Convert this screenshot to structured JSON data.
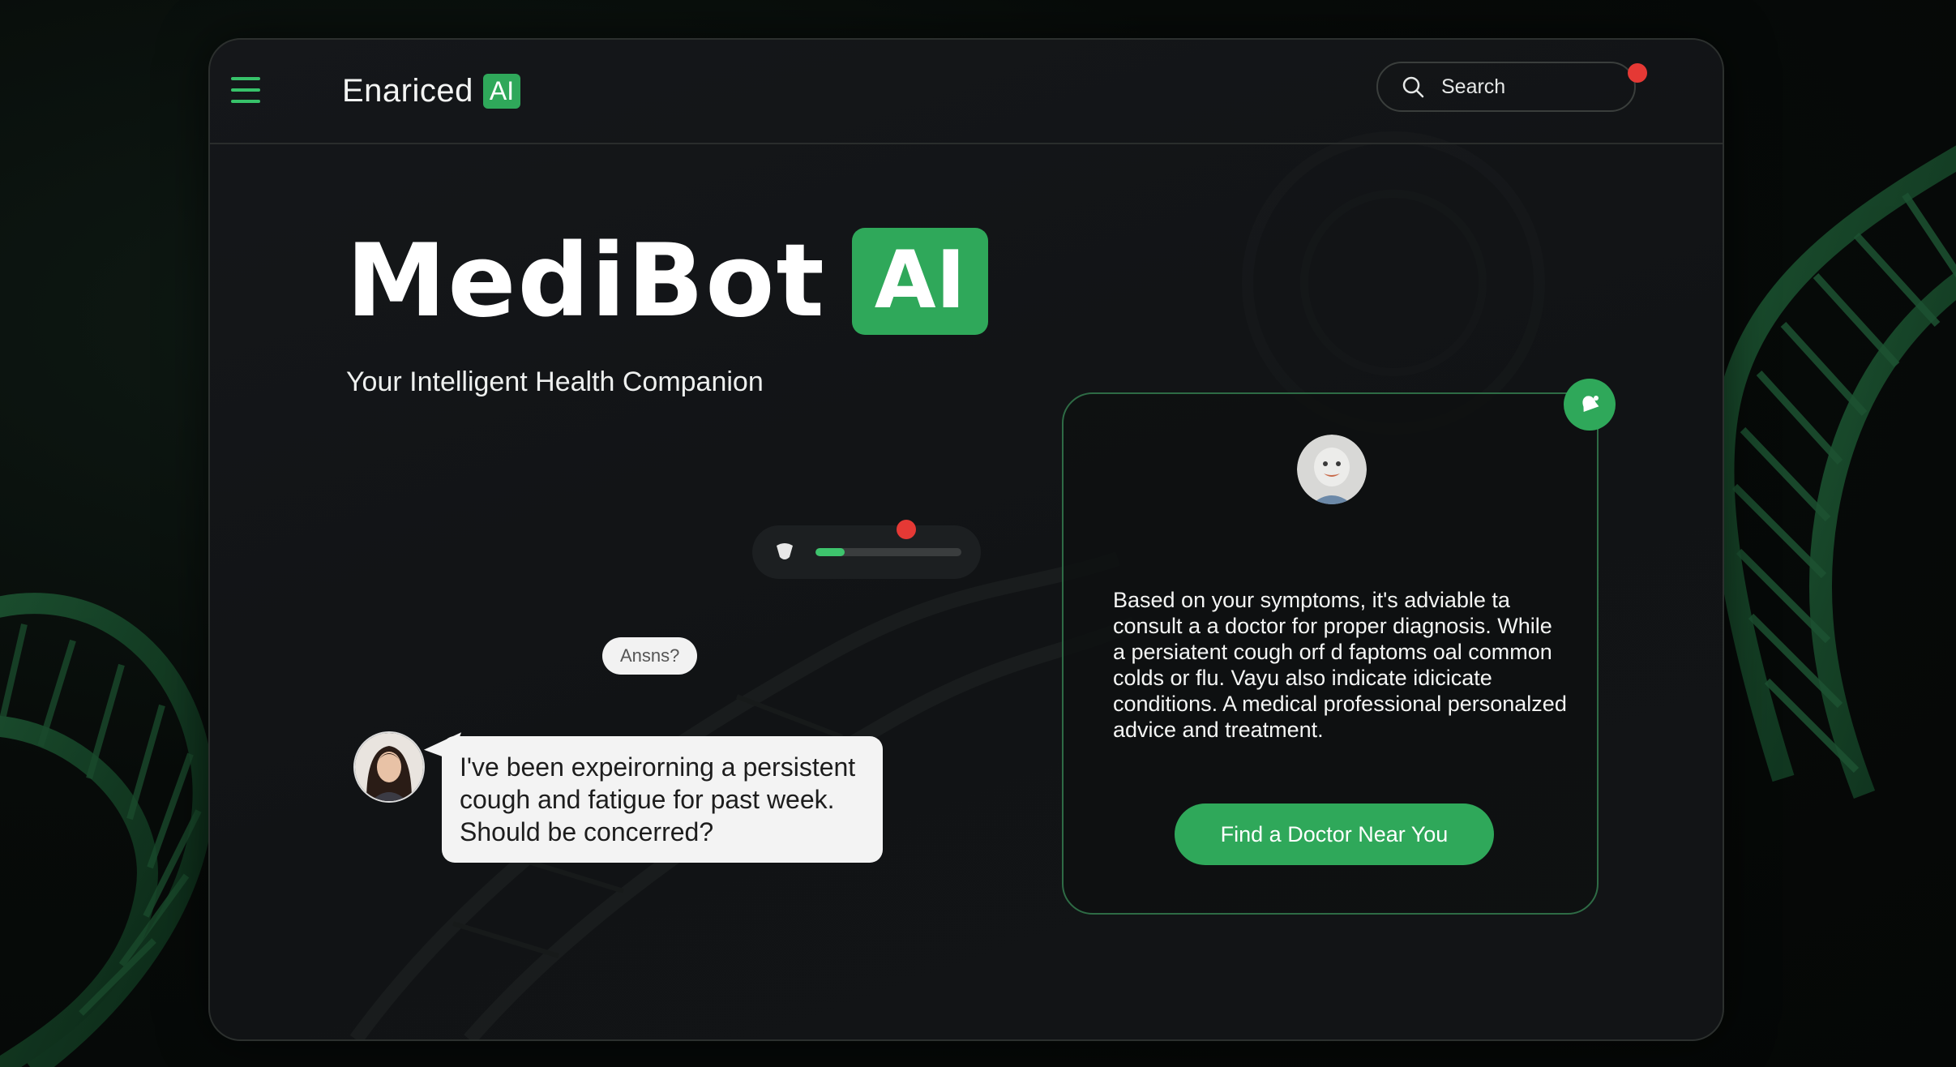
{
  "header": {
    "brand_name": "Enаriced",
    "brand_badge": "AI",
    "search_placeholder": "Search"
  },
  "hero": {
    "title": "MediBot",
    "badge": "AI",
    "subtitle": "Your Intelligent Health Companion"
  },
  "voice_input": {
    "progress_percent": 20
  },
  "chat": {
    "suggestion_chip": "Ansns?",
    "user_message": "I've been expeirorning a persistent cough and fatigue for past week. Should be concerred?"
  },
  "response_card": {
    "text": "Based on your symptoms, it's adviable ta consult a a doctor for proper diagnosis. While a persiatent cough orf d faptoms oal common colds or flu. Vayu also indicate idicicate conditions. A medical professional personalzed advice and treatment.",
    "cta_label": "Find a Doctor Near You"
  },
  "colors": {
    "accent_green": "#2fa85a",
    "alert_red": "#e53935",
    "background": "#111315"
  },
  "icons": {
    "menu": "menu-icon",
    "search": "search-icon",
    "mic": "mic-icon",
    "alert": "bell-icon"
  }
}
